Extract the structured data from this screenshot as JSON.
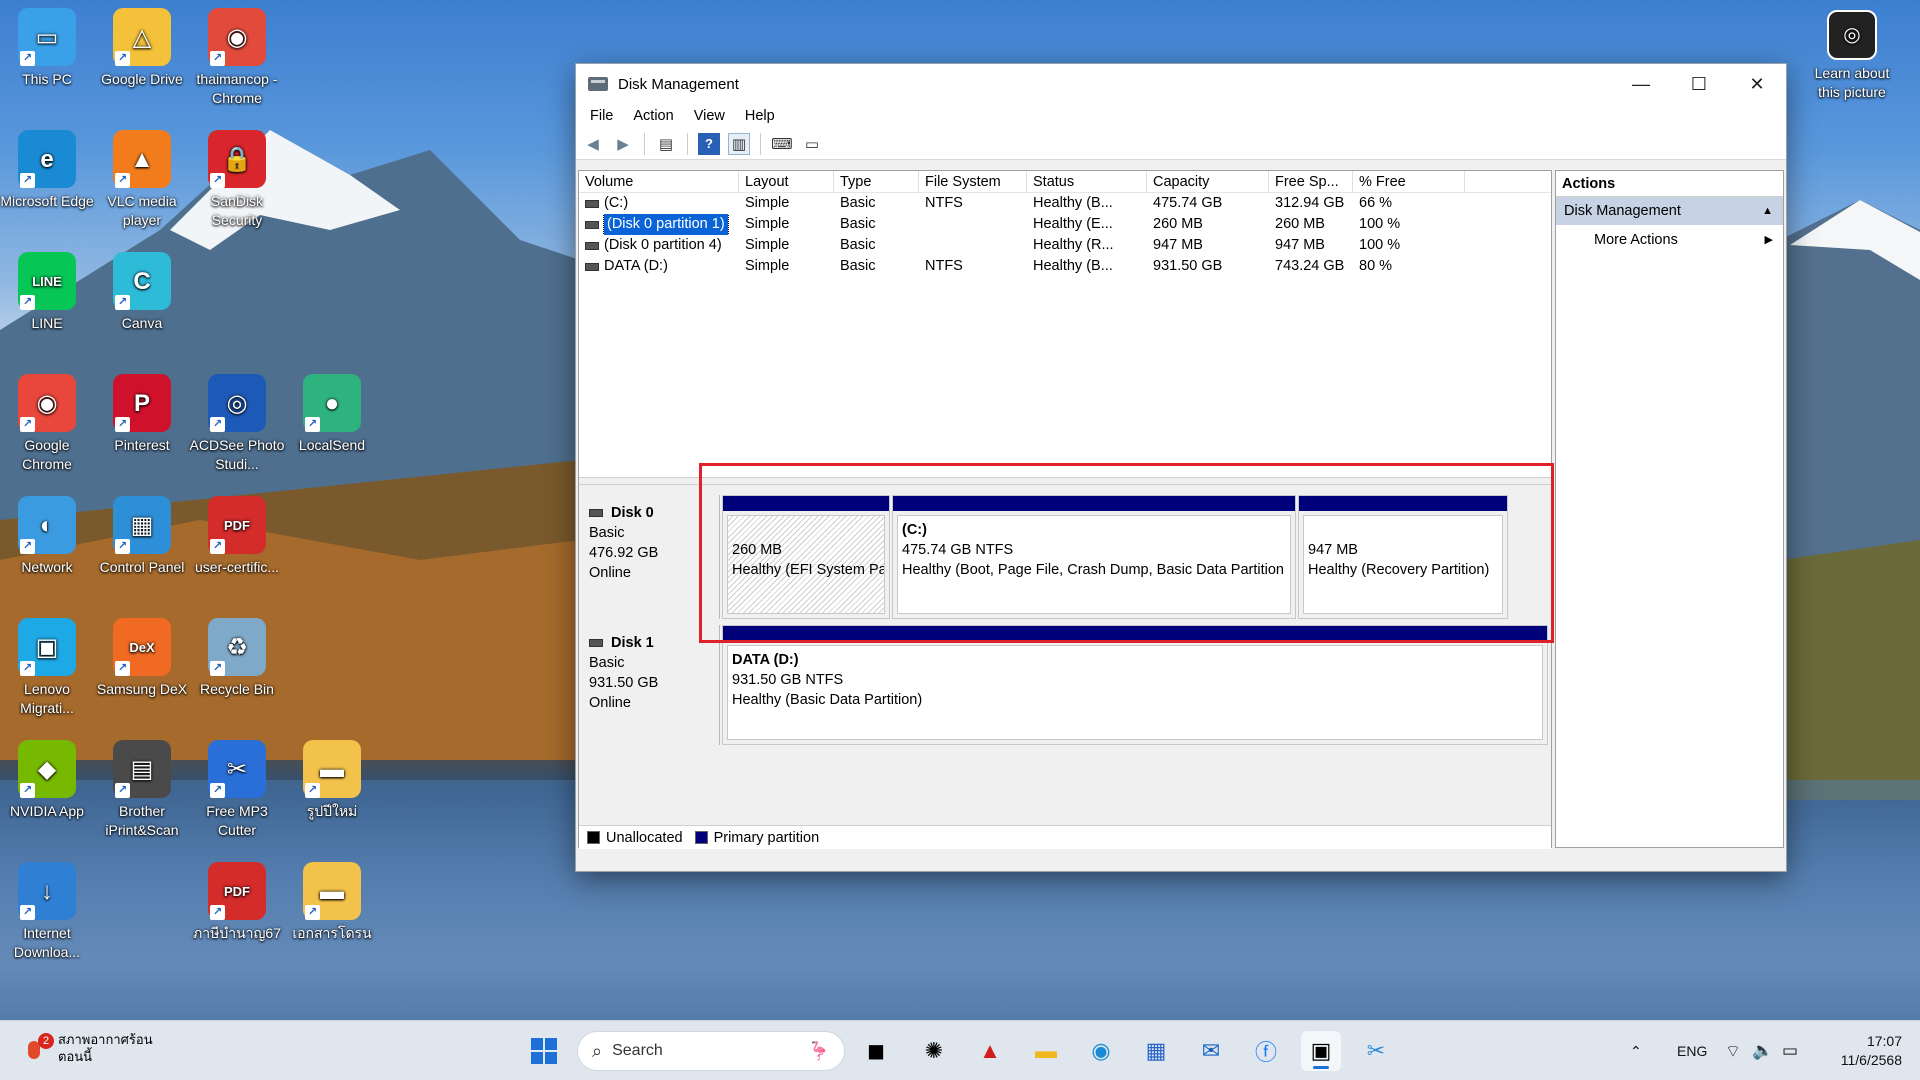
{
  "desktop": {
    "icons": [
      {
        "label": "This PC",
        "icon": "monitor-icon"
      },
      {
        "label": "Google Drive",
        "icon": "google-drive-icon"
      },
      {
        "label": "thaimancop - Chrome",
        "icon": "chrome-profile-icon"
      },
      {
        "label": "Microsoft Edge",
        "icon": "edge-icon"
      },
      {
        "label": "VLC media player",
        "icon": "vlc-icon"
      },
      {
        "label": "SanDisk Security",
        "icon": "lock-icon"
      },
      {
        "label": "LINE",
        "icon": "line-icon"
      },
      {
        "label": "Canva",
        "icon": "canva-icon"
      },
      {
        "label": "Google Chrome",
        "icon": "chrome-icon"
      },
      {
        "label": "Pinterest",
        "icon": "pinterest-icon"
      },
      {
        "label": "ACDSee Photo Studi...",
        "icon": "acdsee-icon"
      },
      {
        "label": "LocalSend",
        "icon": "localsend-icon"
      },
      {
        "label": "Network",
        "icon": "network-icon"
      },
      {
        "label": "Control Panel",
        "icon": "control-panel-icon"
      },
      {
        "label": "user-certific...",
        "icon": "pdf-icon"
      },
      {
        "label": "Lenovo Migrati...",
        "icon": "lenovo-migration-icon"
      },
      {
        "label": "Samsung DeX",
        "icon": "dex-icon"
      },
      {
        "label": "Recycle Bin",
        "icon": "recycle-bin-icon"
      },
      {
        "label": "NVIDIA App",
        "icon": "nvidia-icon"
      },
      {
        "label": "Brother iPrint&Scan",
        "icon": "printer-icon"
      },
      {
        "label": "Free MP3 Cutter",
        "icon": "scissors-icon"
      },
      {
        "label": "รูปปีใหม่",
        "icon": "folder-icon"
      },
      {
        "label": "Internet Downloa...",
        "icon": "idm-icon"
      },
      {
        "label": "ภาษีบำนาญ67",
        "icon": "pdf-icon"
      },
      {
        "label": "เอกสารโดรน",
        "icon": "folder-icon"
      }
    ],
    "spotlight_label": "Learn about this picture"
  },
  "window": {
    "title": "Disk Management",
    "menu": [
      "File",
      "Action",
      "View",
      "Help"
    ],
    "columns": [
      "Volume",
      "Layout",
      "Type",
      "File System",
      "Status",
      "Capacity",
      "Free Sp...",
      "% Free"
    ],
    "volumes": [
      {
        "volume": "(C:)",
        "layout": "Simple",
        "type": "Basic",
        "fs": "NTFS",
        "status": "Healthy (B...",
        "capacity": "475.74 GB",
        "free": "312.94 GB",
        "pct": "66 %"
      },
      {
        "volume": "(Disk 0 partition 1)",
        "layout": "Simple",
        "type": "Basic",
        "fs": "",
        "status": "Healthy (E...",
        "capacity": "260 MB",
        "free": "260 MB",
        "pct": "100 %"
      },
      {
        "volume": "(Disk 0 partition 4)",
        "layout": "Simple",
        "type": "Basic",
        "fs": "",
        "status": "Healthy (R...",
        "capacity": "947 MB",
        "free": "947 MB",
        "pct": "100 %"
      },
      {
        "volume": "DATA (D:)",
        "layout": "Simple",
        "type": "Basic",
        "fs": "NTFS",
        "status": "Healthy (B...",
        "capacity": "931.50 GB",
        "free": "743.24 GB",
        "pct": "80 %"
      }
    ],
    "disks": [
      {
        "name": "Disk 0",
        "type": "Basic",
        "size": "476.92 GB",
        "state": "Online",
        "partitions": [
          {
            "title": "",
            "line1": "260 MB",
            "line2": "Healthy (EFI System Pa"
          },
          {
            "title": "(C:)",
            "line1": "475.74 GB NTFS",
            "line2": "Healthy (Boot, Page File, Crash Dump, Basic Data Partition"
          },
          {
            "title": "",
            "line1": "947 MB",
            "line2": "Healthy (Recovery Partition)"
          }
        ]
      },
      {
        "name": "Disk 1",
        "type": "Basic",
        "size": "931.50 GB",
        "state": "Online",
        "partitions": [
          {
            "title": "DATA (D:)",
            "line1": "931.50 GB NTFS",
            "line2": "Healthy (Basic Data Partition)"
          }
        ]
      }
    ],
    "legend": [
      "Unallocated",
      "Primary partition"
    ],
    "actions": {
      "header": "Actions",
      "section": "Disk Management",
      "item": "More Actions"
    }
  },
  "taskbar": {
    "weather_badge": "2",
    "weather_line1": "สภาพอากาศร้อน",
    "weather_line2": "ตอนนี้",
    "search_placeholder": "Search",
    "language": "ENG",
    "time": "17:07",
    "date": "11/6/2568"
  }
}
